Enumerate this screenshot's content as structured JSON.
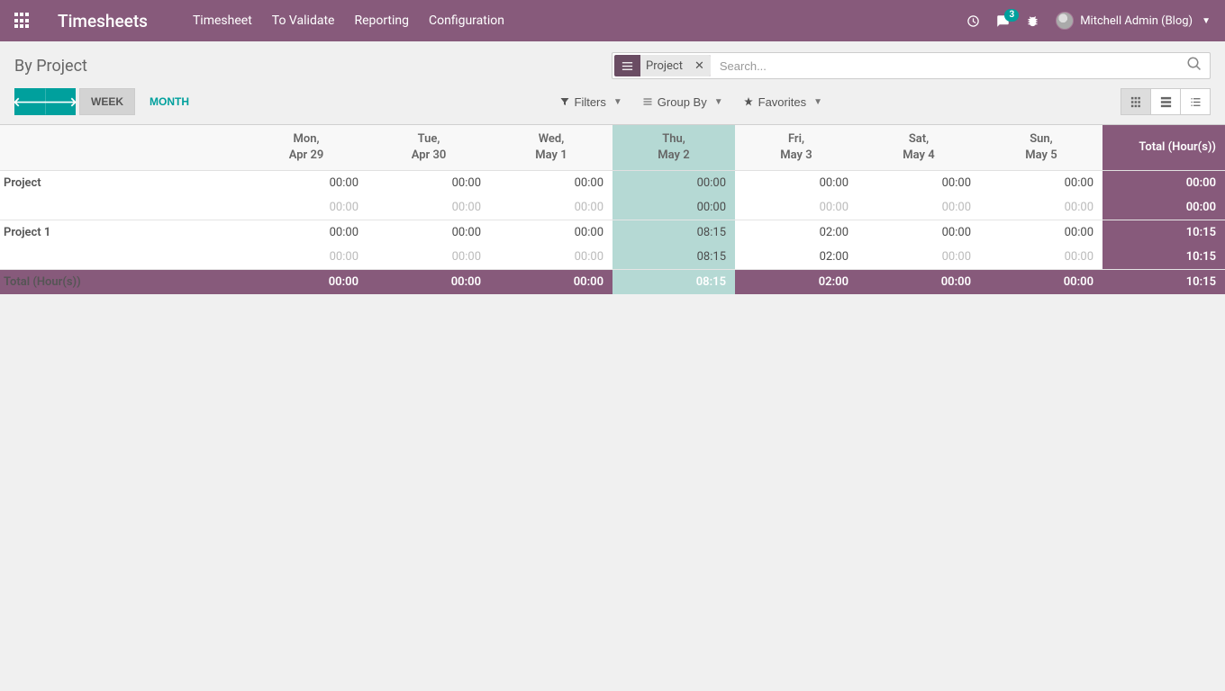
{
  "navbar": {
    "brand": "Timesheets",
    "menu": [
      "Timesheet",
      "To Validate",
      "Reporting",
      "Configuration"
    ],
    "chat_badge": "3",
    "user": "Mitchell Admin (Blog)"
  },
  "control": {
    "title": "By Project",
    "search_chip": "Project",
    "search_placeholder": "Search...",
    "range_week": "WEEK",
    "range_month": "MONTH",
    "filters": "Filters",
    "groupby": "Group By",
    "favorites": "Favorites"
  },
  "grid": {
    "days": [
      {
        "d": "Mon,",
        "date": "Apr 29"
      },
      {
        "d": "Tue,",
        "date": "Apr 30"
      },
      {
        "d": "Wed,",
        "date": "May 1"
      },
      {
        "d": "Thu,",
        "date": "May 2"
      },
      {
        "d": "Fri,",
        "date": "May 3"
      },
      {
        "d": "Sat,",
        "date": "May 4"
      },
      {
        "d": "Sun,",
        "date": "May 5"
      }
    ],
    "total_label": "Total (Hour(s))",
    "today_index": 3,
    "rows": [
      {
        "name": "Project",
        "main": [
          "00:00",
          "00:00",
          "00:00",
          "00:00",
          "00:00",
          "00:00",
          "00:00",
          "00:00"
        ],
        "sub": [
          "00:00",
          "00:00",
          "00:00",
          "00:00",
          "00:00",
          "00:00",
          "00:00",
          "00:00"
        ],
        "sub_dim": [
          true,
          true,
          true,
          false,
          true,
          true,
          true,
          false
        ]
      },
      {
        "name": "Project 1",
        "main": [
          "00:00",
          "00:00",
          "00:00",
          "08:15",
          "02:00",
          "00:00",
          "00:00",
          "10:15"
        ],
        "sub": [
          "00:00",
          "00:00",
          "00:00",
          "08:15",
          "02:00",
          "00:00",
          "00:00",
          "10:15"
        ],
        "sub_dim": [
          true,
          true,
          true,
          false,
          false,
          true,
          true,
          false
        ]
      }
    ],
    "grand_label": "Total (Hour(s))",
    "grand": [
      "00:00",
      "00:00",
      "00:00",
      "08:15",
      "02:00",
      "00:00",
      "00:00",
      "10:15"
    ]
  }
}
